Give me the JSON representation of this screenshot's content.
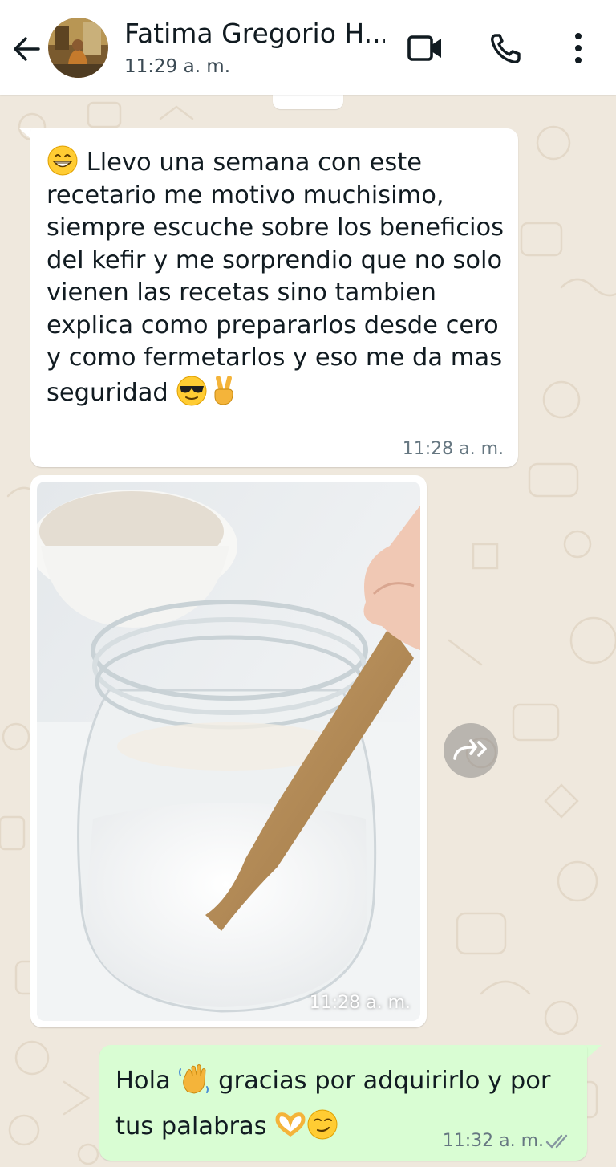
{
  "header": {
    "contact_name": "Fatima Gregorio H...",
    "status": "11:29 a. m.",
    "icons": [
      "back-arrow-icon",
      "video-call-icon",
      "voice-call-icon",
      "more-options-icon"
    ]
  },
  "messages": [
    {
      "direction": "incoming",
      "type": "text",
      "parts": [
        {
          "emoji": "grinning-face"
        },
        {
          "text": " Llevo una semana con este recetario me motivo muchisimo, siempre escuche sobre los beneficios del kefir y me sorprendio que no solo vienen las recetas sino tambien explica como prepararlos desde cero y como fermetarlos y eso me da mas seguridad "
        },
        {
          "emoji": "sunglasses-face"
        },
        {
          "emoji": "victory-hand"
        }
      ],
      "time": "11:28 a. m."
    },
    {
      "direction": "incoming",
      "type": "image",
      "image_subject": "glass-jar-of-kefir-with-wooden-spoon",
      "time": "11:28 a. m."
    },
    {
      "direction": "outgoing",
      "type": "text",
      "parts": [
        {
          "text": "Hola "
        },
        {
          "emoji": "waving-hand"
        },
        {
          "text": " gracias por adquirirlo y por tus palabras "
        },
        {
          "emoji": "heart-hands"
        },
        {
          "emoji": "smirking-face"
        }
      ],
      "time": "11:32 a. m.",
      "read_status": "double-check-read"
    }
  ],
  "colors": {
    "header_bg": "#ffffff",
    "chat_bg": "#efe8dd",
    "incoming_bubble": "#ffffff",
    "outgoing_bubble": "#d9fdd3",
    "timestamp": "#667781",
    "text": "#111b21"
  }
}
